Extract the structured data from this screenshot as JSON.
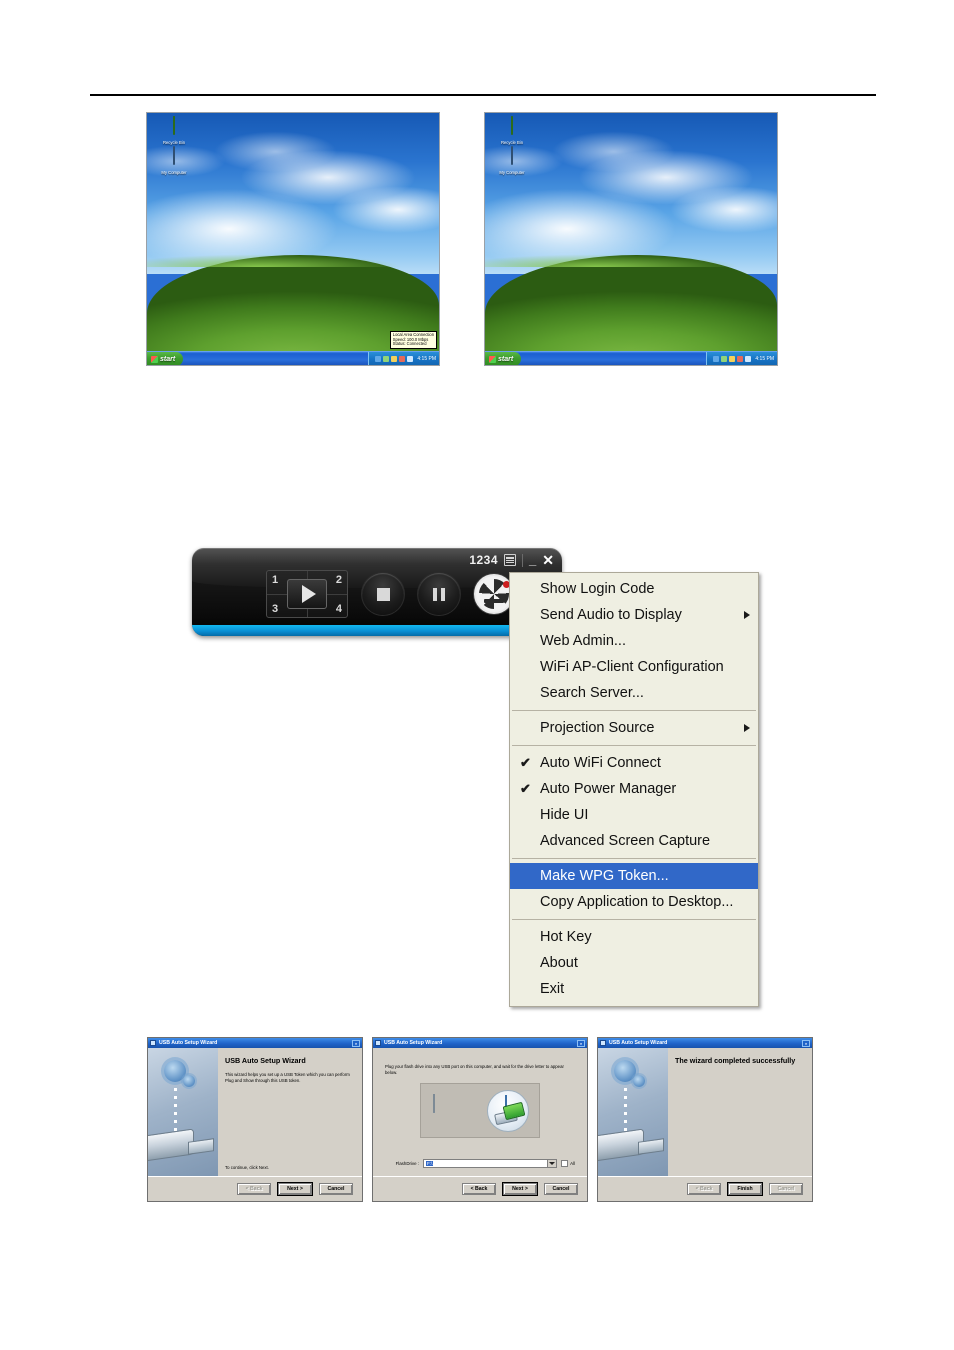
{
  "desktops": [
    {
      "name": "desktop-before",
      "icons": [
        {
          "id": "recycle-bin-icon",
          "label": "Recycle Bin"
        },
        {
          "id": "my-computer-icon",
          "label": "My Computer"
        }
      ],
      "taskbar": {
        "start_label": "start",
        "clock": "4:15 PM"
      },
      "network_tooltip": {
        "line1": "Local Area Connection",
        "line2": "Speed: 100.0 Mbps",
        "line3": "Status: Connected"
      }
    },
    {
      "name": "desktop-after",
      "icons": [
        {
          "id": "recycle-bin-icon",
          "label": "Recycle Bin"
        },
        {
          "id": "my-computer-icon",
          "label": "My Computer"
        }
      ],
      "taskbar": {
        "start_label": "start",
        "clock": "4:15 PM"
      },
      "network_tooltip": null
    }
  ],
  "widget": {
    "name": "wpg-remote-control",
    "login_code": "1234",
    "menu_icon": "menu-icon",
    "minimize_label": "_",
    "close_label": "✕",
    "quad_numbers": [
      "1",
      "2",
      "3",
      "4"
    ],
    "play_label": "play-icon",
    "stop_label": "stop-icon",
    "pause_label": "pause-icon",
    "globe_label": "projector-globe-icon"
  },
  "context_menu": {
    "items": [
      {
        "label": "Show Login Code",
        "checked": false,
        "submenu": false,
        "selected": false,
        "separator_after": false
      },
      {
        "label": "Send Audio to Display",
        "checked": false,
        "submenu": true,
        "selected": false,
        "separator_after": false
      },
      {
        "label": "Web Admin...",
        "checked": false,
        "submenu": false,
        "selected": false,
        "separator_after": false
      },
      {
        "label": "WiFi AP-Client Configuration",
        "checked": false,
        "submenu": false,
        "selected": false,
        "separator_after": false
      },
      {
        "label": "Search Server...",
        "checked": false,
        "submenu": false,
        "selected": false,
        "separator_after": true
      },
      {
        "label": "Projection Source",
        "checked": false,
        "submenu": true,
        "selected": false,
        "separator_after": true
      },
      {
        "label": "Auto WiFi Connect",
        "checked": true,
        "submenu": false,
        "selected": false,
        "separator_after": false
      },
      {
        "label": "Auto Power Manager",
        "checked": true,
        "submenu": false,
        "selected": false,
        "separator_after": false
      },
      {
        "label": "Hide UI",
        "checked": false,
        "submenu": false,
        "selected": false,
        "separator_after": false
      },
      {
        "label": "Advanced Screen Capture",
        "checked": false,
        "submenu": false,
        "selected": false,
        "separator_after": true
      },
      {
        "label": "Make WPG Token...",
        "checked": false,
        "submenu": false,
        "selected": true,
        "separator_after": false
      },
      {
        "label": "Copy Application to Desktop...",
        "checked": false,
        "submenu": false,
        "selected": false,
        "separator_after": true
      },
      {
        "label": "Hot Key",
        "checked": false,
        "submenu": false,
        "selected": false,
        "separator_after": false
      },
      {
        "label": "About",
        "checked": false,
        "submenu": false,
        "selected": false,
        "separator_after": false
      },
      {
        "label": "Exit",
        "checked": false,
        "submenu": false,
        "selected": false,
        "separator_after": false
      }
    ],
    "check_glyph": "✔",
    "highlight_color": "#3168c8",
    "background_color": "#efefe2"
  },
  "wizards": [
    {
      "name": "usb-auto-setup-wizard-step1",
      "title": "USB Auto Setup Wizard",
      "heading": "USB Auto Setup Wizard",
      "body": "This wizard helps you set up a USB Token which you can perform Plug and Show through this USB token.",
      "continue_text": "To continue, click Next.",
      "buttons": [
        {
          "label": "< Back",
          "disabled": true,
          "default": false
        },
        {
          "label": "Next >",
          "disabled": false,
          "default": true
        },
        {
          "label": "Cancel",
          "disabled": false,
          "default": false
        }
      ]
    },
    {
      "name": "usb-auto-setup-wizard-step2",
      "title": "USB Auto Setup Wizard",
      "heading": "",
      "body": "Plug your flash drive into any USB port on this computer, and wait for the drive letter to appear below.",
      "field_label": "FlashDrive :",
      "field_value": "F:\\",
      "all_checkbox_label": "All",
      "all_checkbox_checked": false,
      "buttons": [
        {
          "label": "< Back",
          "disabled": false,
          "default": false
        },
        {
          "label": "Next >",
          "disabled": false,
          "default": true
        },
        {
          "label": "Cancel",
          "disabled": false,
          "default": false
        }
      ]
    },
    {
      "name": "usb-auto-setup-wizard-step3",
      "title": "USB Auto Setup Wizard",
      "heading": "The wizard completed successfully",
      "body": "",
      "buttons": [
        {
          "label": "< Back",
          "disabled": true,
          "default": false
        },
        {
          "label": "Finish",
          "disabled": false,
          "default": true
        },
        {
          "label": "Cancel",
          "disabled": true,
          "default": false
        }
      ]
    }
  ]
}
